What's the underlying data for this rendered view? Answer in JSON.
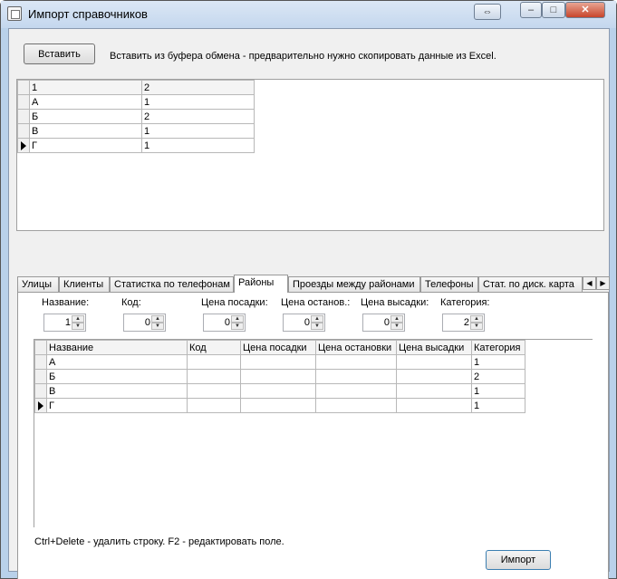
{
  "window": {
    "title": "Импорт справочников",
    "btn_restore": "⇔",
    "btn_minimize": "–",
    "btn_maximize": "□",
    "btn_close": "✕"
  },
  "top": {
    "paste_button": "Вставить",
    "paste_hint": "Вставить из буфера обмена - предварительно нужно скопировать данные из Excel.",
    "grid": {
      "headers": [
        "1",
        "2"
      ],
      "rows": [
        [
          "А",
          "1"
        ],
        [
          "Б",
          "2"
        ],
        [
          "В",
          "1"
        ],
        [
          "Г",
          "1"
        ]
      ]
    }
  },
  "tabs": [
    "Улицы",
    "Клиенты",
    "Статистка по телефонам",
    "Районы",
    "Проезды между районами",
    "Телефоны",
    "Стат. по диск. карта"
  ],
  "active_tab": "Районы",
  "fields": [
    {
      "label": "Название:",
      "value": "1"
    },
    {
      "label": "Код:",
      "value": "0"
    },
    {
      "label": "Цена посадки:",
      "value": "0"
    },
    {
      "label": "Цена останов.:",
      "value": "0"
    },
    {
      "label": "Цена высадки:",
      "value": "0"
    },
    {
      "label": "Категория:",
      "value": "2"
    }
  ],
  "districts_grid": {
    "headers": [
      "Название",
      "Код",
      "Цена посадки",
      "Цена остановки",
      "Цена высадки",
      "Категория"
    ],
    "rows": [
      [
        "А",
        "",
        "",
        "",
        "",
        "1"
      ],
      [
        "Б",
        "",
        "",
        "",
        "",
        "2"
      ],
      [
        "В",
        "",
        "",
        "",
        "",
        "1"
      ],
      [
        "Г",
        "",
        "",
        "",
        "",
        "1"
      ]
    ]
  },
  "bottom": {
    "help": "Ctrl+Delete - удалить строку. F2 - редактировать поле.",
    "import_button": "Импорт"
  }
}
